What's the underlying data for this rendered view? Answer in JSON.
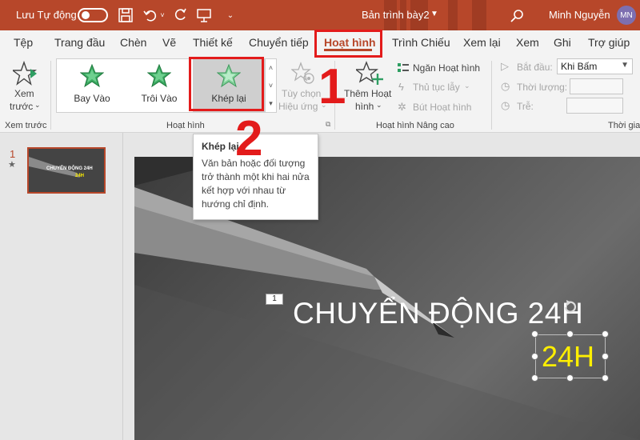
{
  "titlebar": {
    "autosave_label": "Lưu Tự động",
    "doc_title": "Bản trình bày2",
    "user_name": "Minh Nguyễn",
    "avatar_initials": "MN"
  },
  "tabs": [
    {
      "label": "Tệp"
    },
    {
      "label": "Trang đầu"
    },
    {
      "label": "Chèn"
    },
    {
      "label": "Vẽ"
    },
    {
      "label": "Thiết kế"
    },
    {
      "label": "Chuyển tiếp"
    },
    {
      "label": "Hoạt hình"
    },
    {
      "label": "Trình Chiếu"
    },
    {
      "label": "Xem lại"
    },
    {
      "label": "Xem"
    },
    {
      "label": "Ghi"
    },
    {
      "label": "Trợ giúp"
    }
  ],
  "ribbon": {
    "preview": {
      "label_1": "Xem",
      "label_2": "trước",
      "group": "Xem trước"
    },
    "gallery": [
      {
        "label": "Bay Vào"
      },
      {
        "label": "Trôi Vào"
      },
      {
        "label": "Khép lại"
      }
    ],
    "effect_options": {
      "label_1": "Tùy chọn",
      "label_2": "Hiệu ứng"
    },
    "animation_group": "Hoạt hình",
    "add_animation": {
      "label_1": "Thêm Hoạt",
      "label_2": "hình"
    },
    "animation_pane": "Ngăn Hoạt hình",
    "trigger": "Thủ tục lẫy",
    "animation_painter": "Bút Hoạt hình",
    "advanced_group": "Hoạt hình Nâng cao",
    "start_label": "Bắt đầu:",
    "start_value": "Khi Bấm",
    "duration_label": "Thời lượng:",
    "delay_label": "Trễ:",
    "timing_group": "Thời gia"
  },
  "markup": {
    "step1": "1",
    "step2": "2"
  },
  "tooltip": {
    "title": "Khép lại",
    "body": "Văn bản hoặc đối tượng trở thành một khi hai nửa kết hợp với nhau từ hướng chỉ định."
  },
  "slides_pane": {
    "slide_number": "1",
    "thumb_title": "CHUYỂN ĐỘNG 24H",
    "thumb_sub": "24H"
  },
  "slide": {
    "anim_badge": "1",
    "title": "CHUYỂN ĐỘNG 24H",
    "animated_text": "24H"
  },
  "colors": {
    "accent": "#b7472a",
    "highlight": "#e31b1b",
    "animated_text": "#ffef00"
  }
}
